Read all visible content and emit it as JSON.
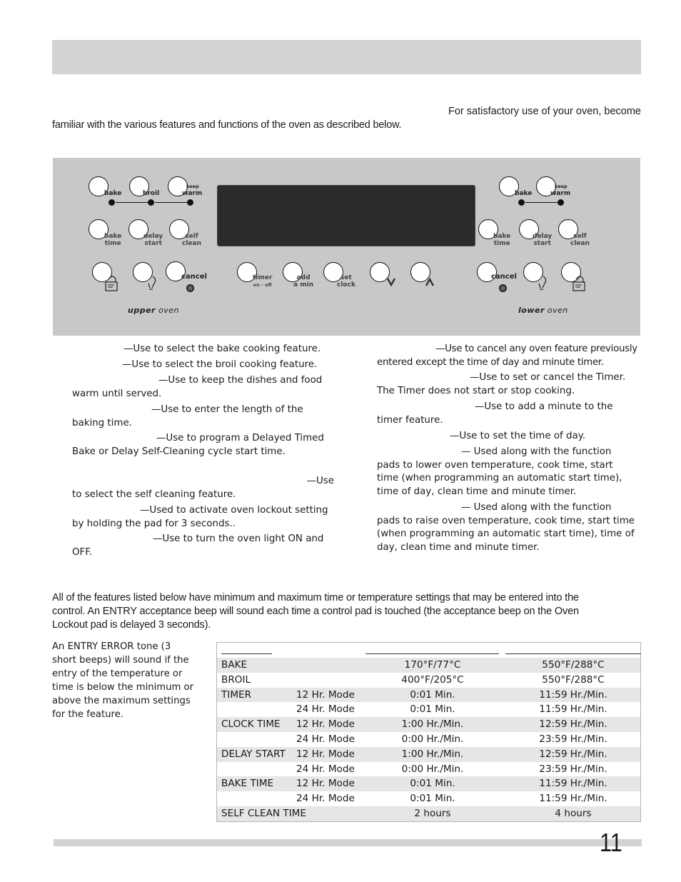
{
  "intro": {
    "line1": "For satisfactory use of your oven, become",
    "line2": "familiar with the various features and functions of the oven as described below."
  },
  "control_panel": {
    "upper_oven": {
      "label_bold": "upper",
      "label_rest": " oven",
      "row1": [
        {
          "id": "bake",
          "label_top": "",
          "label_bottom": "bake"
        },
        {
          "id": "broil",
          "label_top": "",
          "label_bottom": "broil"
        },
        {
          "id": "keep-warm",
          "label_top": "keep",
          "label_bottom": "warm"
        }
      ],
      "row2": [
        {
          "id": "bake-time",
          "line1": "bake",
          "line2": "time"
        },
        {
          "id": "delay-start",
          "line1": "delay",
          "line2": "start"
        },
        {
          "id": "self-clean",
          "line1": "self",
          "line2": "clean"
        }
      ],
      "row3": [
        {
          "id": "oven-lockout",
          "icon": "lock-icon"
        },
        {
          "id": "oven-light",
          "icon": "lightbulb-icon"
        },
        {
          "id": "cancel",
          "label": "cancel"
        }
      ]
    },
    "center": {
      "display": "",
      "pads": [
        {
          "id": "timer",
          "line1": "timer",
          "line2": "on - off"
        },
        {
          "id": "add-minute",
          "line1": "add",
          "line2": "a min"
        },
        {
          "id": "set-clock",
          "line1": "set",
          "line2": "clock"
        },
        {
          "id": "down",
          "symbol": "v"
        },
        {
          "id": "up",
          "symbol": "^"
        }
      ]
    },
    "lower_oven": {
      "label_bold": "lower",
      "label_rest": " oven",
      "row1": [
        {
          "id": "bake",
          "label_top": "",
          "label_bottom": "bake"
        },
        {
          "id": "keep-warm",
          "label_top": "keep",
          "label_bottom": "warm"
        }
      ],
      "row2": [
        {
          "id": "bake-time",
          "line1": "bake",
          "line2": "time"
        },
        {
          "id": "delay-start",
          "line1": "delay",
          "line2": "start"
        },
        {
          "id": "self-clean",
          "line1": "self",
          "line2": "clean"
        }
      ],
      "row3": [
        {
          "id": "cancel",
          "label": "cancel"
        },
        {
          "id": "oven-light",
          "icon": "lightbulb-icon"
        },
        {
          "id": "oven-lockout",
          "icon": "lock-icon"
        }
      ]
    }
  },
  "descriptions_left": [
    {
      "text": "—Use to select the bake cooking feature."
    },
    {
      "text": "—Use to select the broil cooking feature."
    },
    {
      "text": "—Use to keep the dishes and food",
      "cont": "warm until served."
    },
    {
      "text": "—Use to enter the length of the",
      "cont": "baking time."
    },
    {
      "text": "—Use to program a Delayed Timed",
      "cont": "Bake or Delay Self-Cleaning cycle start time."
    },
    {
      "text": "—Use",
      "cont": "to select the self cleaning feature."
    },
    {
      "text": "—Used to activate oven lockout setting",
      "cont": "by holding the pad for 3 seconds.."
    },
    {
      "text": "—Use to turn the oven light ON and",
      "cont": "OFF."
    }
  ],
  "descriptions_right": [
    {
      "text": "—Use to cancel any oven feature previously",
      "cont": "entered except the time of day and minute timer."
    },
    {
      "text": "—Use to set or cancel the Timer.",
      "cont": "The Timer does not start or stop cooking."
    },
    {
      "text": "—Use to add a minute to the",
      "cont": "timer feature."
    },
    {
      "text": "—Use to set the time of day."
    },
    {
      "text": "— Used along with the function",
      "cont": "pads to lower oven temperature, cook time, start",
      "cont2": "time (when programming an automatic start time),",
      "cont3": "time of day, clean time and minute timer."
    },
    {
      "text": "— Used along with the function",
      "cont": "pads to raise oven temperature, cook time, start time",
      "cont2": "(when programming an automatic start time), time of",
      "cont3": "day, clean time and minute timer."
    }
  ],
  "features_paragraph": {
    "line1": "All of the features listed below have minimum and maximum time or temperature settings that may be entered into the",
    "line2": "control. An ENTRY acceptance beep will sound each time a control pad is touched (the acceptance beep on the Oven",
    "line3": "Lockout pad is delayed 3 seconds)."
  },
  "error_paragraph": {
    "lines": [
      "An ENTRY ERROR tone (3",
      "short beeps) will sound if the",
      "entry of the temperature or",
      "time is below the minimum or",
      "above the maximum settings",
      "for the feature."
    ]
  },
  "settings_table": {
    "rows": [
      {
        "feature": "BAKE",
        "mode": "",
        "min": "170°F/77°C",
        "max": "550°F/288°C"
      },
      {
        "feature": "BROIL",
        "mode": "",
        "min": "400°F/205°C",
        "max": "550°F/288°C"
      },
      {
        "feature": "TIMER",
        "mode": "12 Hr. Mode",
        "min": "0:01 Min.",
        "max": "11:59 Hr./Min."
      },
      {
        "feature": "",
        "mode": "24 Hr. Mode",
        "min": "0:01 Min.",
        "max": "11:59 Hr./Min."
      },
      {
        "feature": "CLOCK TIME",
        "mode": "12 Hr. Mode",
        "min": "1:00 Hr./Min.",
        "max": "12:59 Hr./Min."
      },
      {
        "feature": "",
        "mode": "24 Hr. Mode",
        "min": "0:00 Hr./Min.",
        "max": "23:59 Hr./Min."
      },
      {
        "feature": "DELAY START",
        "mode": "12 Hr. Mode",
        "min": "1:00 Hr./Min.",
        "max": "12:59 Hr./Min."
      },
      {
        "feature": "",
        "mode": "24 Hr. Mode",
        "min": "0:00 Hr./Min.",
        "max": "23:59 Hr./Min."
      },
      {
        "feature": "BAKE TIME",
        "mode": "12 Hr. Mode",
        "min": "0:01 Min.",
        "max": "11:59 Hr./Min."
      },
      {
        "feature": "",
        "mode": "24 Hr. Mode",
        "min": "0:01 Min.",
        "max": "11:59 Hr./Min."
      },
      {
        "feature": "SELF CLEAN TIME",
        "mode": "",
        "min": "2 hours",
        "max": "4 hours"
      }
    ]
  },
  "page_number": "11"
}
